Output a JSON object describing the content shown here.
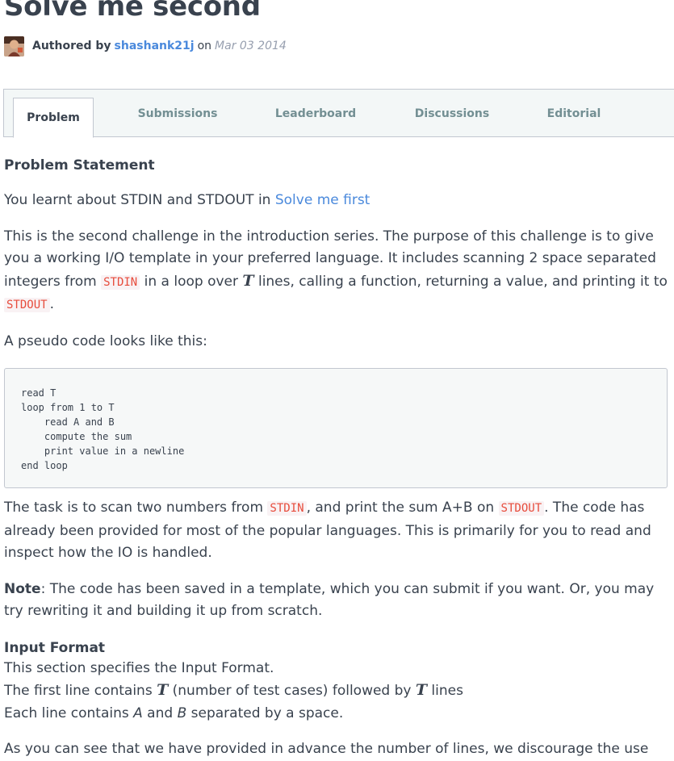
{
  "challenge": {
    "title": "Solve me second",
    "author_prefix": "Authored by",
    "author_name": "shashank21j",
    "author_on": "on",
    "date": "Mar 03 2014"
  },
  "tabs": [
    {
      "label": "Problem",
      "active": true
    },
    {
      "label": "Submissions",
      "active": false
    },
    {
      "label": "Leaderboard",
      "active": false
    },
    {
      "label": "Discussions",
      "active": false
    },
    {
      "label": "Editorial",
      "active": false
    }
  ],
  "statement": {
    "heading": "Problem Statement",
    "p1_text": "You learnt about STDIN and STDOUT in ",
    "p1_link": "Solve me first",
    "p2_a": "This is the second challenge in the introduction series. The purpose of this challenge is to give you a working I/O template in your preferred language. It includes scanning 2 space separated integers from ",
    "p2_code1": "STDIN",
    "p2_b": " in a loop over ",
    "p2_var": "T",
    "p2_c": " lines, calling a function, returning a value, and printing it to ",
    "p2_code2": "STDOUT",
    "p2_d": ".",
    "p3": "A pseudo code looks like this:",
    "pseudo_code": "read T\nloop from 1 to T\n    read A and B\n    compute the sum\n    print value in a newline\nend loop",
    "p4_a": "The task is to scan two numbers from ",
    "p4_code1": "STDIN",
    "p4_b": ", and print the sum A+B on ",
    "p4_code2": "STDOUT",
    "p4_c": ". The code has already been provided for most of the popular languages. This is primarily for you to read and inspect how the IO is handled.",
    "note_label": "Note",
    "note_text": ": The code has been saved in a template, which you can submit if you want. Or, you may try rewriting it and building it up from scratch.",
    "input_heading": "Input Format",
    "input_line1": "This section specifies the Input Format.",
    "input_line2_a": "The first line contains ",
    "input_line2_var1": "T",
    "input_line2_b": " (number of test cases) followed by ",
    "input_line2_var2": "T",
    "input_line2_c": " lines",
    "input_line3_a": "Each line contains ",
    "input_line3_A": "A",
    "input_line3_b": " and ",
    "input_line3_B": "B",
    "input_line3_c": " separated by a space.",
    "p_last": "As you can see that we have provided in advance the number of lines, we discourage the use"
  }
}
